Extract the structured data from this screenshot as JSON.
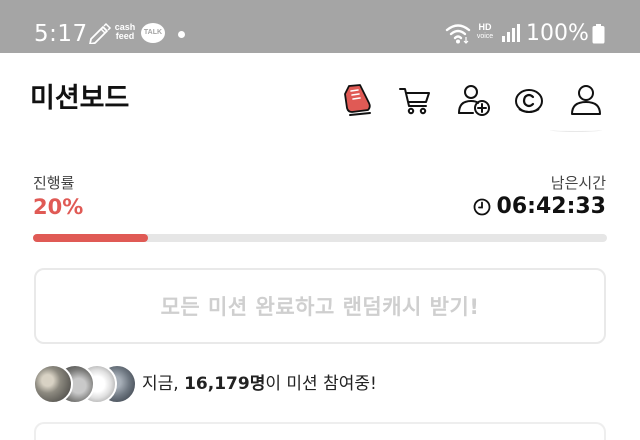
{
  "status_bar": {
    "time": "5:17",
    "cash_line1": "cash",
    "cash_line2": "feed",
    "talk_label": "TALK",
    "hd_label": "HD",
    "voice_label": "voice",
    "battery": "100%"
  },
  "header": {
    "title": "미션보드",
    "icons": [
      "shoe-icon",
      "cart-icon",
      "add-friend-icon",
      "coin-icon",
      "profile-icon"
    ]
  },
  "progress": {
    "label": "진행률",
    "value": "20%",
    "fraction": 0.2,
    "remaining_label": "남은시간",
    "remaining_time": "06:42:33"
  },
  "reward_button": {
    "label": "모든 미션 완료하고 랜덤캐시 받기!"
  },
  "participants": {
    "prefix": "지금, ",
    "count": "16,179명",
    "suffix": "이 미션 참여중!"
  },
  "colors": {
    "accent": "#e05a55",
    "status_bar": "#a5a5a5",
    "track": "#e6e6e6",
    "button_border": "#e9e9e9",
    "button_text": "#cfcfcf"
  }
}
